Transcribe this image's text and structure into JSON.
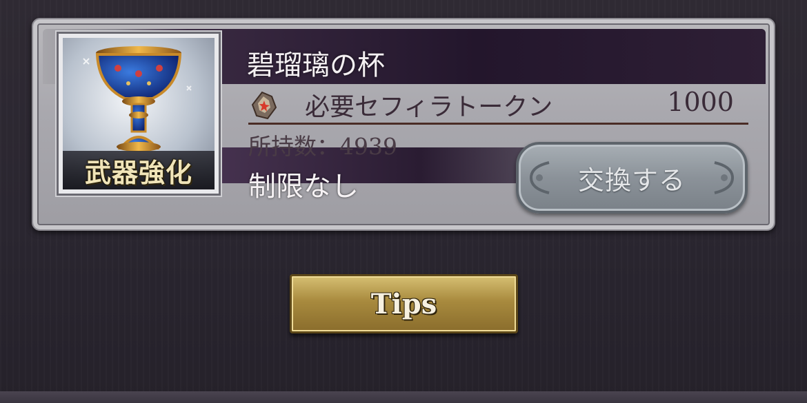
{
  "item": {
    "name": "碧瑠璃の杯",
    "badge": "武器強化",
    "icon": "chalice-icon"
  },
  "cost": {
    "icon": "sephira-token-icon",
    "label": "必要セフィラトークン",
    "value": "1000"
  },
  "owned": {
    "label": "所持数：",
    "count": "4939"
  },
  "limit": "制限なし",
  "exchange_button": "交換する",
  "tips_button": "Tips",
  "colors": {
    "card_frame": "#a9a8ae",
    "name_band": "#23162c",
    "tips_gold": "#a88a3e",
    "exchange_silver": "#8b9299"
  }
}
